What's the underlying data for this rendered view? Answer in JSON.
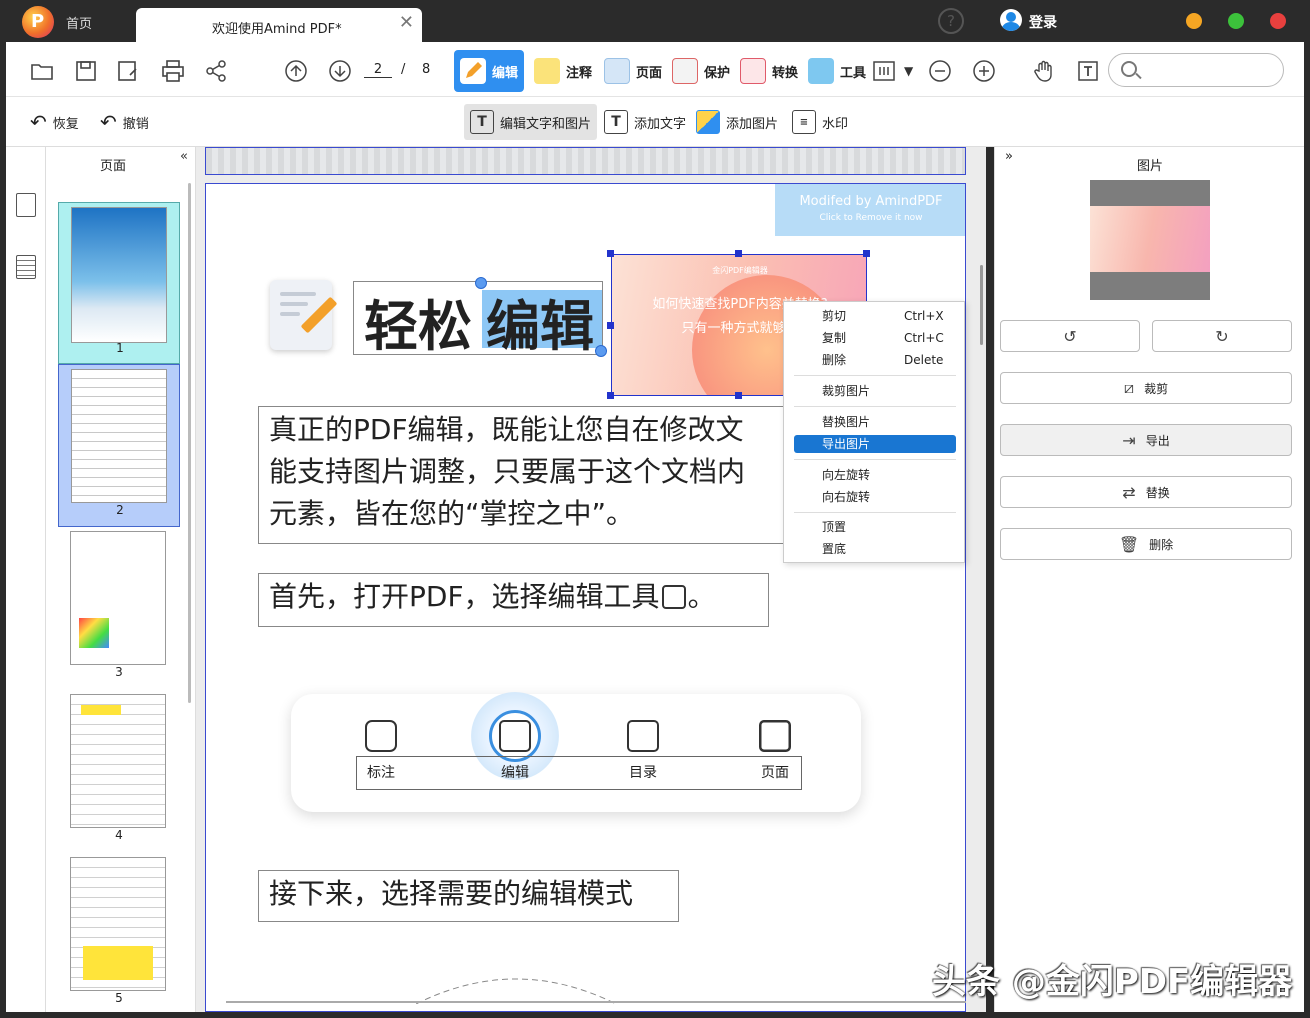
{
  "tabbar": {
    "home_tab": "首页",
    "doc_tab": "欢迎使用Amind PDF*",
    "close_glyph": "✕",
    "help_glyph": "?",
    "login": "登录",
    "window_buttons": {
      "minimize": "#f5a623",
      "maximize": "#3cc13b",
      "close": "#e8403e"
    }
  },
  "toolbar": {
    "page_current": "2",
    "page_sep": "/",
    "page_total": "8",
    "tabs": [
      {
        "label": "编辑",
        "icon": "edit-icon"
      },
      {
        "label": "注释",
        "icon": "comment-icon"
      },
      {
        "label": "页面",
        "icon": "page-icon"
      },
      {
        "label": "保护",
        "icon": "protect-icon"
      },
      {
        "label": "转换",
        "icon": "convert-icon"
      },
      {
        "label": "工具",
        "icon": "tools-icon"
      }
    ],
    "zoom_dropdown": "▼",
    "accent": "#2f8ff0"
  },
  "subtoolbar": {
    "redo": "恢复",
    "undo": "撤销",
    "edit_text_image": "编辑文字和图片",
    "add_text": "添加文字",
    "add_image": "添加图片",
    "watermark": "水印"
  },
  "left_panel": {
    "title": "页面",
    "collapse": "«",
    "thumbnails": [
      {
        "number": "1"
      },
      {
        "number": "2"
      },
      {
        "number": "3"
      },
      {
        "number": "4"
      },
      {
        "number": "5"
      }
    ]
  },
  "document": {
    "banner_title": "Modifed by AmindPDF",
    "banner_sub": "Click to Remove it now",
    "title_plain": "轻松",
    "title_selected": "编辑",
    "image_line1": "金闪PDF编辑器",
    "image_line2": "如何快速查找PDF内容并替换?",
    "image_line3": "只有一种方式就够了",
    "paragraph1": "真正的PDF编辑，既能让您自在修改文字，也能支持图片调整，只要属于这个文档内的元素，皆在您的“掌控之中”。",
    "paragraph1_lines": [
      "真正的PDF编辑，既能让您自在修改文",
      "能支持图片调整，只要属于这个文档内",
      "元素，皆在您的“掌控之中”。"
    ],
    "paragraph2": "首先，打开PDF，选择编辑工具",
    "paragraph2_end": "。",
    "toolbox": [
      {
        "label": "标注",
        "icon": "annotate-icon"
      },
      {
        "label": "编辑",
        "icon": "edit-icon"
      },
      {
        "label": "目录",
        "icon": "toc-icon"
      },
      {
        "label": "页面",
        "icon": "grid-icon"
      }
    ],
    "paragraph3": "接下来，选择需要的编辑模式"
  },
  "context_menu": [
    {
      "label": "剪切",
      "shortcut": "Ctrl+X"
    },
    {
      "label": "复制",
      "shortcut": "Ctrl+C"
    },
    {
      "label": "删除",
      "shortcut": "Delete"
    },
    {
      "label": "裁剪图片",
      "shortcut": ""
    },
    {
      "label": "替换图片",
      "shortcut": ""
    },
    {
      "label": "导出图片",
      "shortcut": "",
      "active": true
    },
    {
      "label": "向左旋转",
      "shortcut": ""
    },
    {
      "label": "向右旋转",
      "shortcut": ""
    },
    {
      "label": "顶置",
      "shortcut": ""
    },
    {
      "label": "置底",
      "shortcut": ""
    }
  ],
  "right_panel": {
    "collapse": "»",
    "title": "图片",
    "crop": "裁剪",
    "export": "导出",
    "replace": "替换",
    "delete": "删除"
  },
  "watermark_text": "头条 @金闪PDF编辑器"
}
